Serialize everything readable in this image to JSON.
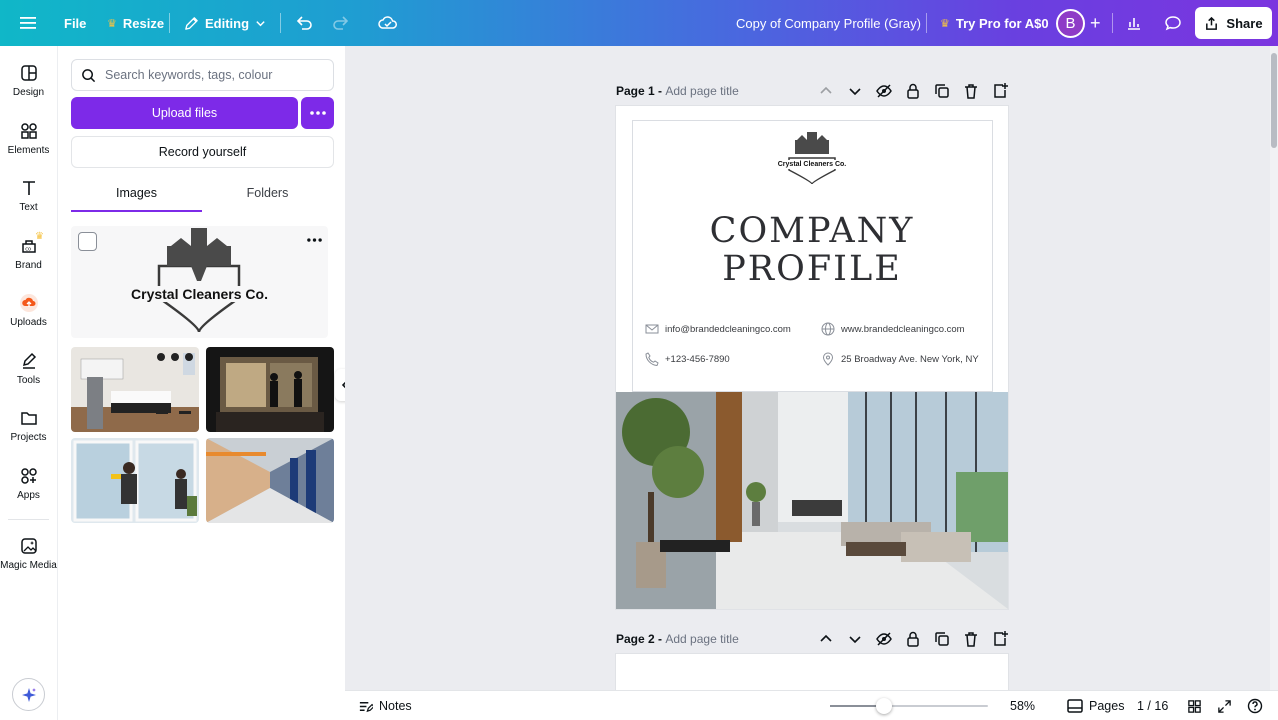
{
  "topbar": {
    "file_label": "File",
    "resize_label": "Resize",
    "editing_label": "Editing",
    "doc_title": "Copy of Company Profile (Gray)",
    "try_pro_label": "Try Pro for A$0",
    "avatar_initial": "B",
    "share_label": "Share"
  },
  "rail": {
    "items": [
      {
        "label": "Design",
        "icon": "layout-icon"
      },
      {
        "label": "Elements",
        "icon": "shapes-icon"
      },
      {
        "label": "Text",
        "icon": "text-icon"
      },
      {
        "label": "Brand",
        "icon": "brand-icon"
      },
      {
        "label": "Uploads",
        "icon": "upload-cloud-icon"
      },
      {
        "label": "Tools",
        "icon": "pen-icon"
      },
      {
        "label": "Projects",
        "icon": "folder-icon"
      },
      {
        "label": "Apps",
        "icon": "apps-icon"
      },
      {
        "label": "Magic Media",
        "icon": "magic-media-icon"
      }
    ]
  },
  "panel": {
    "search_placeholder": "Search keywords, tags, colour",
    "upload_label": "Upload files",
    "record_label": "Record yourself",
    "tabs": [
      {
        "label": "Images",
        "active": true
      },
      {
        "label": "Folders",
        "active": false
      }
    ],
    "logo_text": "Crystal Cleaners Co."
  },
  "canvas": {
    "page1_label": "Page 1 - ",
    "page1_sub": "Add page title",
    "page2_label": "Page 2 - ",
    "page2_sub": "Add page title",
    "logo_small_text": "Crystal Cleaners Co.",
    "title_line1": "COMPANY",
    "title_line2": "PROFILE",
    "email": "info@brandedcleaningco.com",
    "website": "www.brandedcleaningco.com",
    "phone": "+123-456-7890",
    "address": "25 Broadway Ave. New York, NY"
  },
  "bottombar": {
    "notes_label": "Notes",
    "zoom": "58%",
    "zoom_value": 58,
    "pages_label": "Pages",
    "page_counter": "1 / 16"
  },
  "colors": {
    "accent": "#7d2ae8",
    "avatar": "#8e3bc7"
  }
}
